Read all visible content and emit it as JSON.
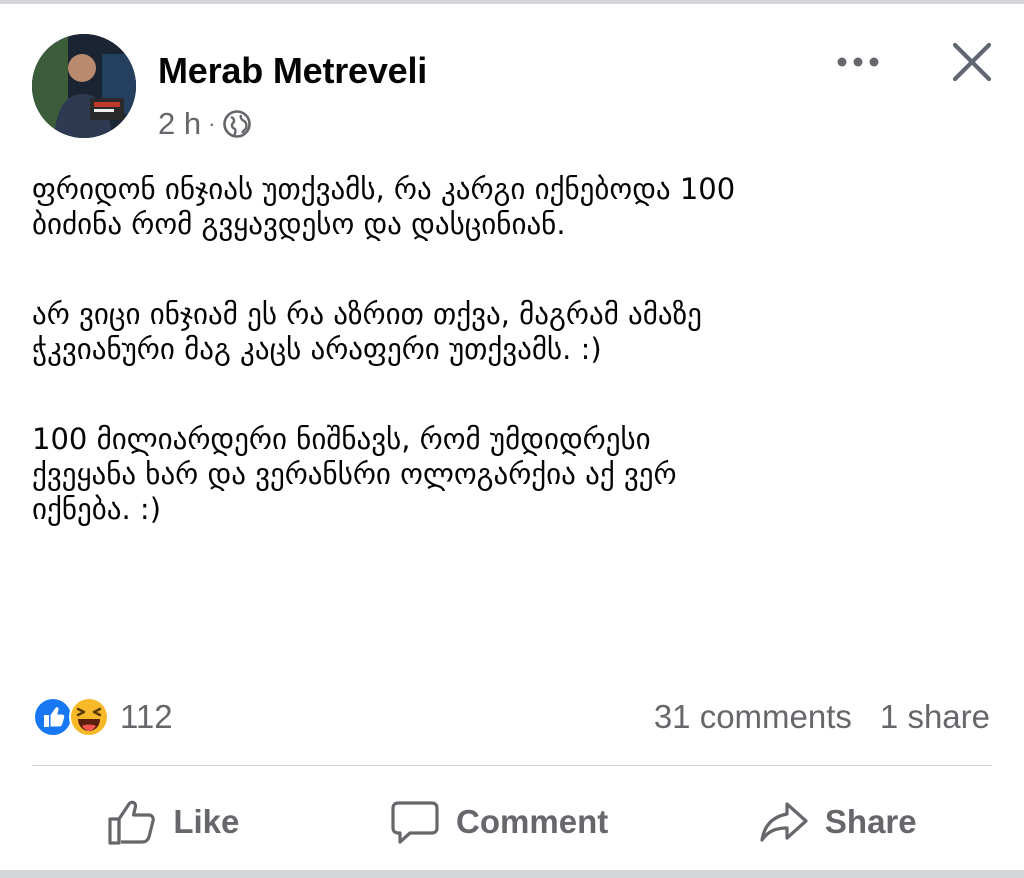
{
  "post": {
    "author": "Merab Metreveli",
    "time": "2 h",
    "separator": "·",
    "audience_icon": "globe-icon",
    "paragraphs": [
      [
        "ფრიდონ ინჯიას უთქვამს, რა კარგი იქნებოდა 100",
        "ბიძინა რომ გვყავდესო და დასცინიან."
      ],
      [
        "არ ვიცი ინჯიამ ეს რა აზრით თქვა, მაგრამ ამაზე",
        "ჭკვიანური მაგ კაცს არაფერი უთქვამს. :)"
      ],
      [
        "100 მილიარდერი ნიშნავს, რომ უმდიდრესი",
        "ქვეყანა ხარ და ვერანსრი ოლოგარქია აქ ვერ",
        "იქნება. :)"
      ]
    ]
  },
  "header_icons": {
    "more": "more-horizontal-icon",
    "close": "close-icon"
  },
  "engagement": {
    "reaction_icons": [
      "like-reaction-icon",
      "haha-reaction-icon"
    ],
    "reaction_count": "112",
    "comments": "31 comments",
    "shares": "1 share"
  },
  "actions": {
    "like": "Like",
    "comment": "Comment",
    "share": "Share"
  },
  "colors": {
    "like_blue": "#1877f2",
    "haha_yellow": "#f7b928",
    "secondary_text": "#65676b",
    "primary_text": "#050505"
  }
}
